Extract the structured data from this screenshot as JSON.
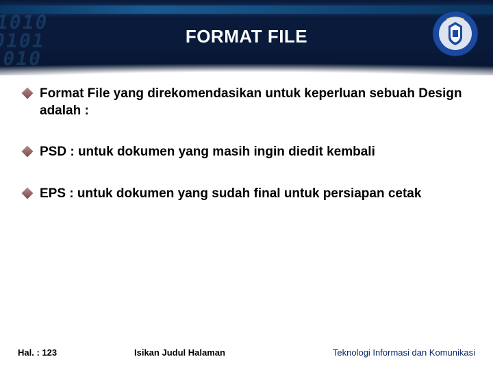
{
  "header": {
    "title": "FORMAT FILE",
    "binary_decoration": "1010\n0101\n1010",
    "logo": {
      "name": "education-emblem-logo",
      "ring_color": "#1a4aa0",
      "inner_color": "#e8e8f0",
      "top_text_color": "#f0d060"
    }
  },
  "bullets": [
    {
      "text": "Format File yang direkomendasikan untuk keperluan sebuah Design adalah :"
    },
    {
      "text": "PSD : untuk dokumen yang masih ingin diedit kembali"
    },
    {
      "text": "EPS : untuk dokumen yang sudah final untuk persiapan cetak"
    }
  ],
  "footer": {
    "page_label": "Hal. : 123",
    "center_text": "Isikan Judul Halaman",
    "right_text": "Teknologi Informasi dan Komunikasi"
  }
}
